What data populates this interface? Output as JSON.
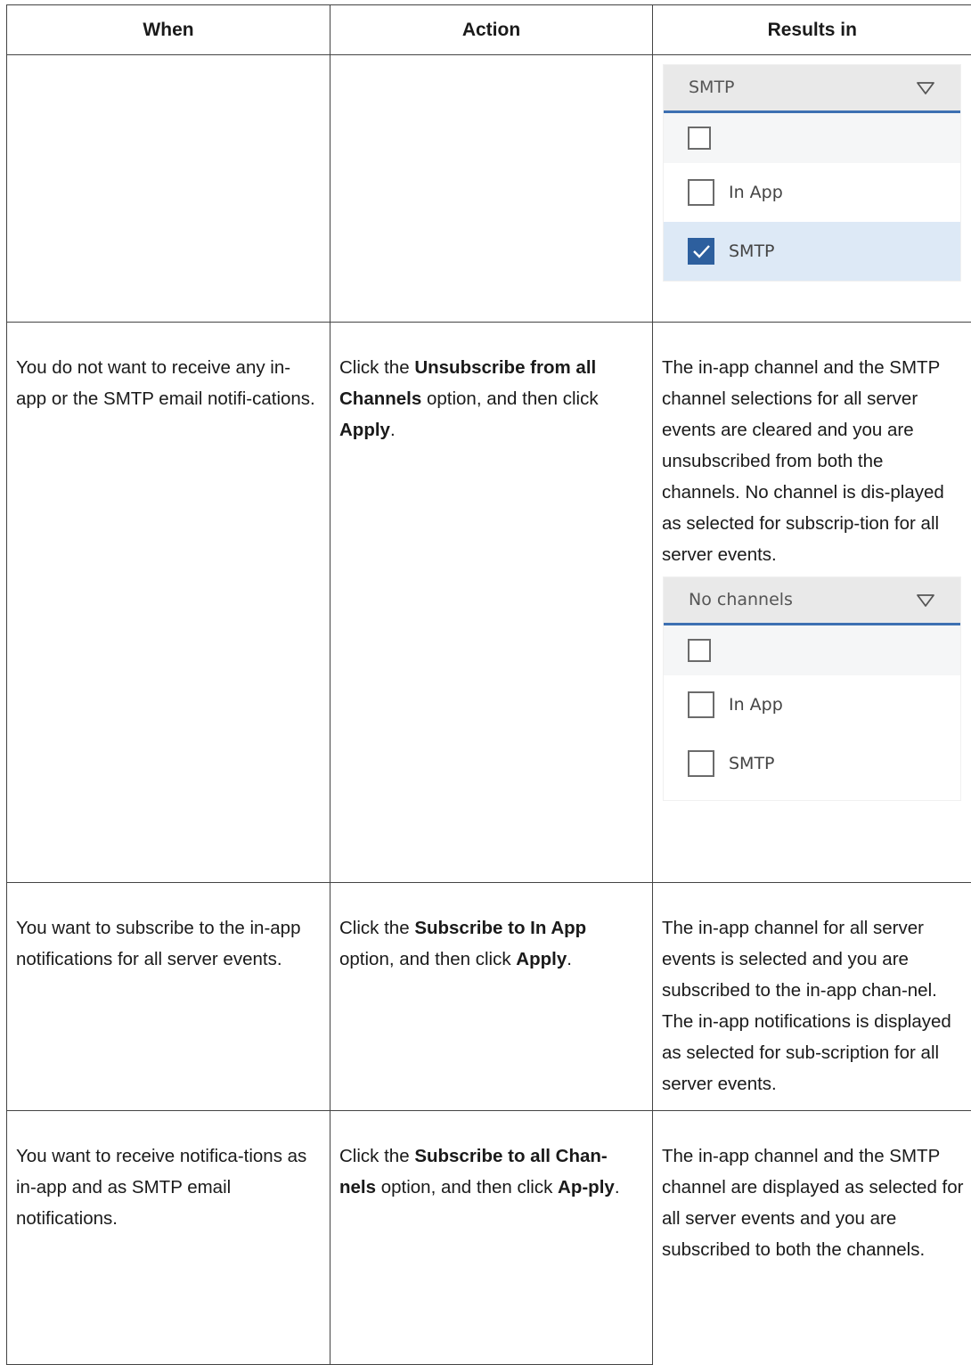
{
  "table": {
    "headers": {
      "when": "When",
      "action": "Action",
      "results": "Results in"
    }
  },
  "row1": {
    "dropdown": {
      "selected": "SMTP",
      "options": [
        {
          "label": "",
          "checked": false
        },
        {
          "label": "In App",
          "checked": false
        },
        {
          "label": "SMTP",
          "checked": true
        }
      ]
    }
  },
  "row2": {
    "when": "You do not want to receive any in-app or the SMTP email notifi-cations.",
    "action_pre": "Click the ",
    "action_bold1": "Unsubscribe from all Channels",
    "action_mid": " option, and then click ",
    "action_bold2": "Apply",
    "action_post": ".",
    "result": "The in-app channel and the SMTP channel selections for all server events are cleared and you are unsubscribed from both the channels. No channel is dis-played as selected for subscrip-tion for all server events.",
    "dropdown": {
      "selected": "No channels",
      "options": [
        {
          "label": "",
          "checked": false
        },
        {
          "label": "In App",
          "checked": false
        },
        {
          "label": "SMTP",
          "checked": false
        }
      ]
    }
  },
  "row3": {
    "when": "You want to subscribe to the in-app notifications for all server events.",
    "action_pre": "Click the ",
    "action_bold1": "Subscribe to In App",
    "action_mid": " option, and then click ",
    "action_bold2": "Apply",
    "action_post": ".",
    "result": "The in-app channel for all server events is selected and you are subscribed to the in-app chan-nel. The in-app notifications is displayed as selected for sub-scription for all server events."
  },
  "row4": {
    "when": "You want to receive notifica-tions as in-app and as SMTP email notifications.",
    "action_pre": "Click the ",
    "action_bold1": "Subscribe to all Chan-nels",
    "action_mid": " option, and then click ",
    "action_bold2": "Ap-ply",
    "action_post": ".",
    "result": "The in-app channel and the SMTP channel are displayed as selected for all server events and you are subscribed to both the channels."
  },
  "icons": {
    "dropdown_arrow": "triangle-down-outline-icon",
    "checkmark": "checkmark-icon"
  },
  "colors": {
    "accent": "#3d70b2",
    "checked_fill": "#2d5f9e",
    "selected_row": "#dde9f6",
    "header_bg": "#e9e9e9"
  }
}
